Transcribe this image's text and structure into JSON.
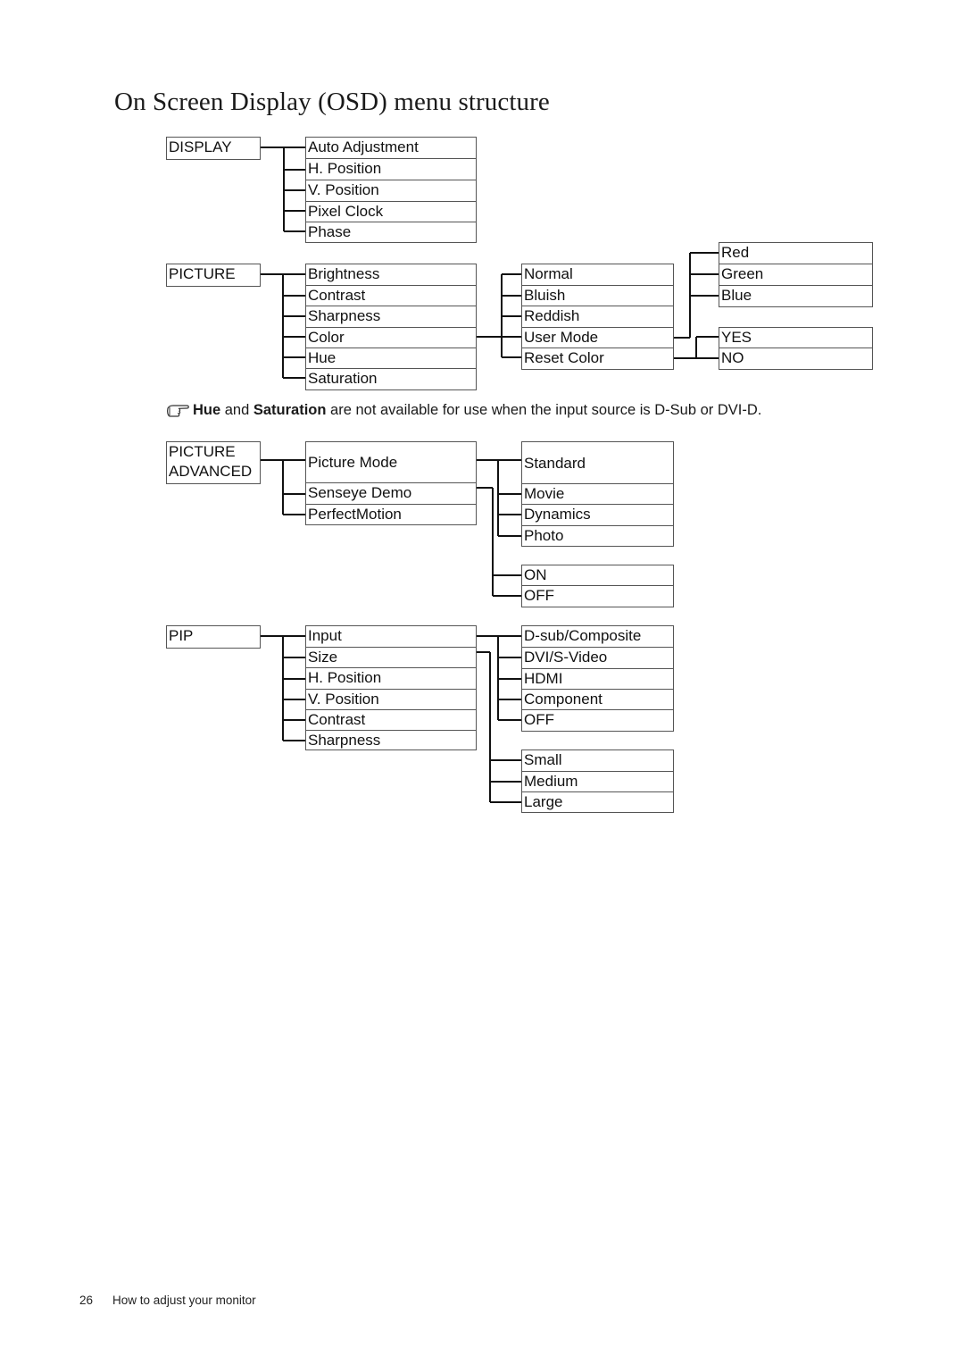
{
  "page": {
    "title": "On Screen Display (OSD) menu structure",
    "footer": {
      "page_number": "26",
      "section": "How to adjust your monitor"
    }
  },
  "menus": {
    "display": {
      "label": "DISPLAY",
      "items": [
        "Auto Adjustment",
        "H. Position",
        "V. Position",
        "Pixel Clock",
        "Phase"
      ]
    },
    "picture": {
      "label": "PICTURE",
      "items": [
        "Brightness",
        "Contrast",
        "Sharpness",
        "Color",
        "Hue",
        "Saturation"
      ],
      "color_options": [
        "Normal",
        "Bluish",
        "Reddish",
        "User Mode",
        "Reset Color"
      ],
      "user_mode_options": [
        "Red",
        "Green",
        "Blue"
      ],
      "reset_color_options": [
        "YES",
        "NO"
      ]
    },
    "picture_advanced": {
      "label_line1": "PICTURE",
      "label_line2": "ADVANCED",
      "items": [
        "Picture Mode",
        "Senseye Demo",
        "PerfectMotion"
      ],
      "picture_mode_options": [
        "Standard",
        "Movie",
        "Dynamics",
        "Photo"
      ],
      "senseye_demo_options": [
        "ON",
        "OFF"
      ]
    },
    "pip": {
      "label": "PIP",
      "items": [
        "Input",
        "Size",
        "H. Position",
        "V. Position",
        "Contrast",
        "Sharpness"
      ],
      "input_options": [
        "D-sub/Composite",
        "DVI/S-Video",
        "HDMI",
        "Component",
        "OFF"
      ],
      "size_options": [
        "Small",
        "Medium",
        "Large"
      ]
    }
  },
  "note": {
    "icon": "pointing-hand-icon",
    "bold1": "Hue",
    "text1": " and ",
    "bold2": "Saturation",
    "text2": " are not available for use when the input source is D-Sub or DVI-D."
  }
}
